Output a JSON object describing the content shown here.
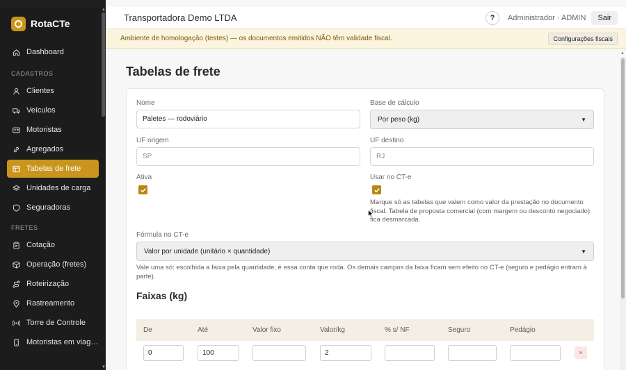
{
  "brand": {
    "name": "RotaCTe"
  },
  "sidebar": {
    "items_top": [
      {
        "label": "Dashboard",
        "icon": "home-icon"
      }
    ],
    "section_cadastros": "CADASTROS",
    "cadastros": [
      {
        "label": "Clientes",
        "icon": "user-icon"
      },
      {
        "label": "Veículos",
        "icon": "truck-icon"
      },
      {
        "label": "Motoristas",
        "icon": "id-card-icon"
      },
      {
        "label": "Agregados",
        "icon": "link-icon"
      },
      {
        "label": "Tabelas de frete",
        "icon": "table-icon",
        "active": true
      },
      {
        "label": "Unidades de carga",
        "icon": "layers-icon"
      },
      {
        "label": "Seguradoras",
        "icon": "shield-icon"
      }
    ],
    "section_fretes": "FRETES",
    "fretes": [
      {
        "label": "Cotação",
        "icon": "clipboard-icon"
      },
      {
        "label": "Operação (fretes)",
        "icon": "package-icon"
      },
      {
        "label": "Roteirização",
        "icon": "route-icon"
      },
      {
        "label": "Rastreamento",
        "icon": "map-pin-icon"
      },
      {
        "label": "Torre de Controle",
        "icon": "broadcast-icon"
      },
      {
        "label": "Motoristas em viag…",
        "icon": "mobile-icon"
      }
    ]
  },
  "topbar": {
    "company": "Transportadora Demo LTDA",
    "help": "?",
    "user": "Administrador · ADMIN",
    "logout": "Sair"
  },
  "banner": {
    "text": "Ambiente de homologação (testes) — os documentos emitidos NÃO têm validade fiscal.",
    "button": "Configurações fiscais"
  },
  "page": {
    "title": "Tabelas de frete"
  },
  "form": {
    "nome_label": "Nome",
    "nome_value": "Paletes — rodoviário",
    "base_label": "Base de cálculo",
    "base_value": "Por peso (kg)",
    "uf_origem_label": "UF origem",
    "uf_origem_placeholder": "SP",
    "uf_destino_label": "UF destino",
    "uf_destino_placeholder": "RJ",
    "ativa_label": "Ativa",
    "ativa_checked": true,
    "usar_cte_label": "Usar no CT-e",
    "usar_cte_checked": true,
    "usar_cte_help": "Marque só as tabelas que valem como valor da prestação no documento fiscal. Tabela de proposta comercial (com margem ou desconto negociado) fica desmarcada.",
    "formula_label": "Fórmula no CT-e",
    "formula_value": "Valor por unidade (unitário × quantidade)",
    "formula_help": "Vale uma só: escolhida a faixa pela quantidade, é essa conta que roda. Os demais campos da faixa ficam sem efeito no CT-e (seguro e pedágio entram à parte)."
  },
  "faixas": {
    "title": "Faixas (kg)",
    "columns": [
      "De",
      "Até",
      "Valor fixo",
      "Valor/kg",
      "% s/ NF",
      "Seguro",
      "Pedágio"
    ],
    "rows": [
      {
        "de": "0",
        "ate": "100",
        "valor_fixo": "",
        "valor_kg": "2",
        "pct_nf": "",
        "seguro": "",
        "pedagio": ""
      }
    ],
    "delete_label": "×"
  },
  "colors": {
    "accent": "#c9951c",
    "sidebar_bg": "#1c1c1c",
    "banner_bg": "#fbf4de"
  }
}
